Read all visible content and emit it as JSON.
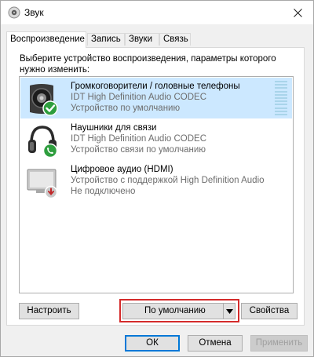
{
  "window": {
    "title": "Звук"
  },
  "tabs": [
    {
      "label": "Воспроизведение",
      "active": true
    },
    {
      "label": "Запись",
      "active": false
    },
    {
      "label": "Звуки",
      "active": false
    },
    {
      "label": "Связь",
      "active": false
    }
  ],
  "panel": {
    "instruction": "Выберите устройство воспроизведения, параметры которого нужно изменить:"
  },
  "devices": [
    {
      "name": "Громкоговорители / головные телефоны",
      "driver": "IDT High Definition Audio CODEC",
      "status": "Устройство по умолчанию",
      "icon": "speaker-icon",
      "badge": "default-check-badge",
      "selected": true
    },
    {
      "name": "Наушники для связи",
      "driver": "IDT High Definition Audio CODEC",
      "status": "Устройство связи по умолчанию",
      "icon": "headphones-icon",
      "badge": "communications-phone-badge",
      "selected": false
    },
    {
      "name": "Цифровое аудио (HDMI)",
      "driver": "Устройство с поддержкой High Definition Audio",
      "status": "Не подключено",
      "icon": "monitor-icon",
      "badge": "disconnected-badge",
      "selected": false
    }
  ],
  "buttons": {
    "configure": "Настроить",
    "set_default": "По умолчанию",
    "properties": "Свойства",
    "ok": "ОК",
    "cancel": "Отмена",
    "apply": "Применить"
  },
  "colors": {
    "selection": "#cce8ff",
    "highlight": "#d42b2b",
    "check_green": "#2e9e3e",
    "accent": "#0078d7"
  }
}
